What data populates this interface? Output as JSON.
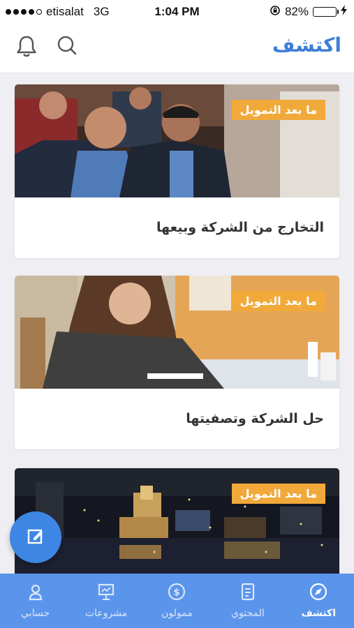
{
  "status_bar": {
    "carrier": "etisalat",
    "network": "3G",
    "time": "1:04 PM",
    "battery_percent": "82%",
    "battery_level": 0.82
  },
  "header": {
    "title": "اكتشف",
    "bell_icon": "bell-icon",
    "search_icon": "search-icon"
  },
  "colors": {
    "accent": "#3d7fd6",
    "badge": "#f1a93a",
    "tab_bar": "#5b95eb",
    "fab": "#3d86e3"
  },
  "feed": {
    "cards": [
      {
        "badge": "ما بعد التمويل",
        "title": "التخارج من الشركة وبيعها"
      },
      {
        "badge": "ما بعد التمويل",
        "title": "حل الشركة وتصفيتها"
      },
      {
        "badge": "ما بعد التمويل",
        "title": ""
      }
    ]
  },
  "fab": {
    "icon": "edit-icon"
  },
  "tab_bar": {
    "items": [
      {
        "label": "اكتشف",
        "icon": "compass-icon",
        "active": true
      },
      {
        "label": "المحتوي",
        "icon": "document-icon",
        "active": false
      },
      {
        "label": "ممولون",
        "icon": "dollar-icon",
        "active": false
      },
      {
        "label": "مشروعات",
        "icon": "presentation-icon",
        "active": false
      },
      {
        "label": "حسابي",
        "icon": "user-icon",
        "active": false
      }
    ]
  }
}
